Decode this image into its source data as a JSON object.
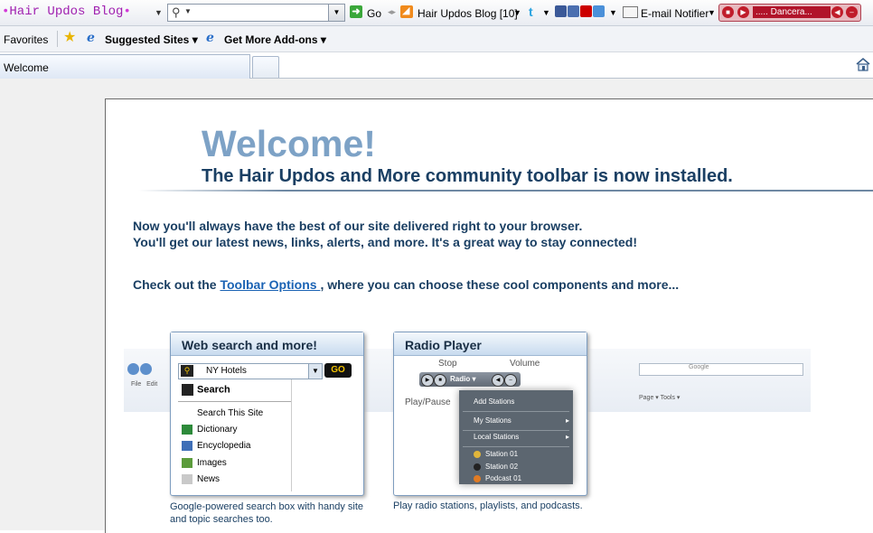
{
  "toolbar": {
    "brand": "Hair Updos Blog",
    "go_label": "Go",
    "rss_label": "Hair Updos Blog [10]",
    "email_label": "E-mail Notifier",
    "radio_station": "..... Dancera..."
  },
  "favorites_bar": {
    "favorites_label": "Favorites",
    "suggested_sites": "Suggested Sites",
    "get_more_addons": "Get More Add-ons"
  },
  "tabs": {
    "active_title": "Welcome"
  },
  "page": {
    "welcome_heading": "Welcome!",
    "subheading": "The Hair Updos and More community toolbar is now installed.",
    "intro_line1": "Now you'll always have the best of our site delivered right to your browser.",
    "intro_line2": "You'll get our latest news, links, alerts, and more. It's a great way to stay connected!",
    "check_prefix": "Check out the ",
    "toolbar_options_link": "Toolbar Options ",
    "check_suffix": ", where you can choose these cool components and more..."
  },
  "search_panel": {
    "title": "Web search and more!",
    "query": "NY Hotels",
    "menu_header": "Search",
    "items": [
      "Search This Site",
      "Dictionary",
      "Encyclopedia",
      "Images",
      "News"
    ],
    "caption": "Google-powered search box with handy site and topic searches too."
  },
  "radio_panel": {
    "title": "Radio Player",
    "label_stop": "Stop",
    "label_volume": "Volume",
    "label_play_pause": "Play/Pause",
    "control_label": "Radio",
    "menu_items": [
      "Add Stations",
      "My Stations",
      "Local Stations",
      "Station 01",
      "Station 02",
      "Podcast 01"
    ],
    "caption": "Play radio stations, playlists, and podcasts."
  },
  "browser_mock": {
    "menu_file": "File",
    "menu_edit": "Edit",
    "search_hint": "Google",
    "right_tools": "Page ▾  Tools ▾"
  },
  "colors": {
    "welcome": "#7da2c6",
    "heading": "#1a3f63",
    "link": "#1b63b4",
    "brand": "#a020b0",
    "radio_accent": "#c01c2a"
  }
}
